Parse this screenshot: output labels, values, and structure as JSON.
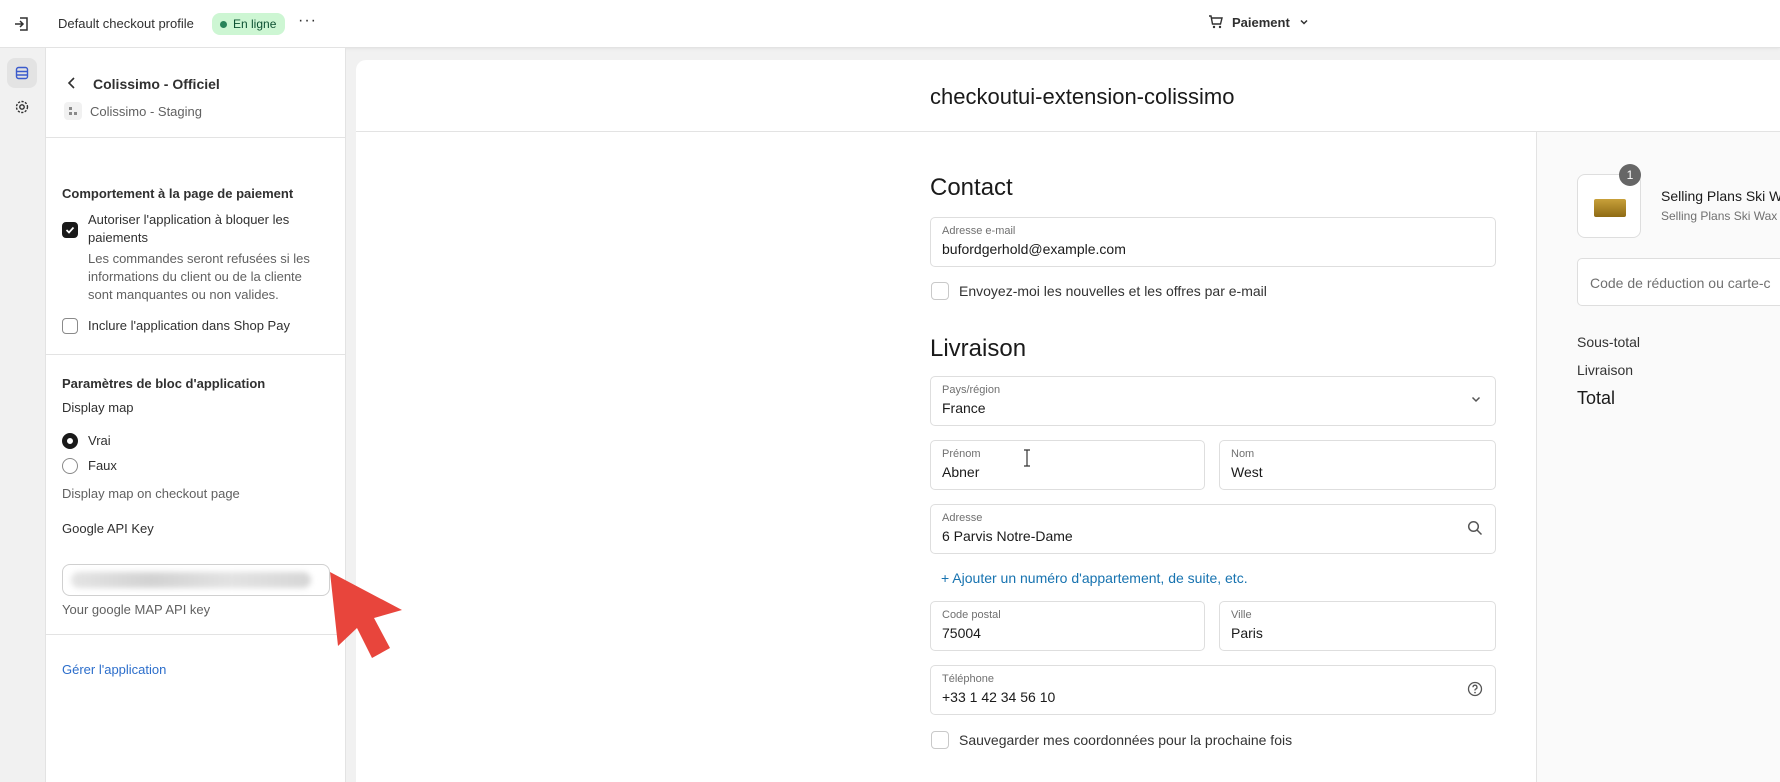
{
  "topbar": {
    "profile_name": "Default checkout profile",
    "status": "En ligne",
    "more": "···",
    "page_selector": "Paiement"
  },
  "panel": {
    "app_title": "Colissimo - Officiel",
    "staging_label": "Colissimo - Staging",
    "behavior": {
      "title": "Comportement à la page de paiement",
      "block_payments_label_1": "Autoriser l'application à bloquer les",
      "block_payments_label_2": "paiements",
      "block_payments_checked": true,
      "help_1": "Les commandes seront refusées si les",
      "help_2": "informations du client ou de la cliente",
      "help_3": "sont manquantes ou non valides.",
      "shop_pay_label": "Inclure l'application dans Shop Pay",
      "shop_pay_checked": false
    },
    "block_settings": {
      "title": "Paramètres de bloc d'application",
      "display_map_label": "Display map",
      "option_true": "Vrai",
      "option_false": "Faux",
      "selected": "Vrai",
      "display_map_help": "Display map on checkout page",
      "api_key_label": "Google API Key",
      "api_key_help": "Your google MAP API key"
    },
    "manage_link": "Gérer l'application"
  },
  "preview": {
    "store_title": "checkoutui-extension-colissimo",
    "contact": {
      "title": "Contact",
      "email_label": "Adresse e-mail",
      "email_value": "bufordgerhold@example.com",
      "newsletter_label": "Envoyez-moi les nouvelles et les offres par e-mail"
    },
    "delivery": {
      "title": "Livraison",
      "country_label": "Pays/région",
      "country_value": "France",
      "first_name_label": "Prénom",
      "first_name_value": "Abner",
      "last_name_label": "Nom",
      "last_name_value": "West",
      "address_label": "Adresse",
      "address_value": "6 Parvis Notre-Dame",
      "add_apartment": "+ Ajouter un numéro d'appartement, de suite, etc.",
      "postal_label": "Code postal",
      "postal_value": "75004",
      "city_label": "Ville",
      "city_value": "Paris",
      "phone_label": "Téléphone",
      "phone_value": "+33 1 42 34 56 10",
      "save_label": "Sauvegarder mes coordonnées pour la prochaine fois"
    },
    "summary": {
      "quantity": "1",
      "product_name": "Selling Plans Ski Wa",
      "product_variant": "Selling Plans Ski Wax",
      "discount_placeholder": "Code de réduction ou carte-c",
      "subtotal_label": "Sous-total",
      "shipping_label": "Livraison",
      "total_label": "Total"
    }
  },
  "colors": {
    "accent_link": "#2c6ecb",
    "status_bg": "#cdf6d3",
    "arrow": "#e8453c"
  }
}
